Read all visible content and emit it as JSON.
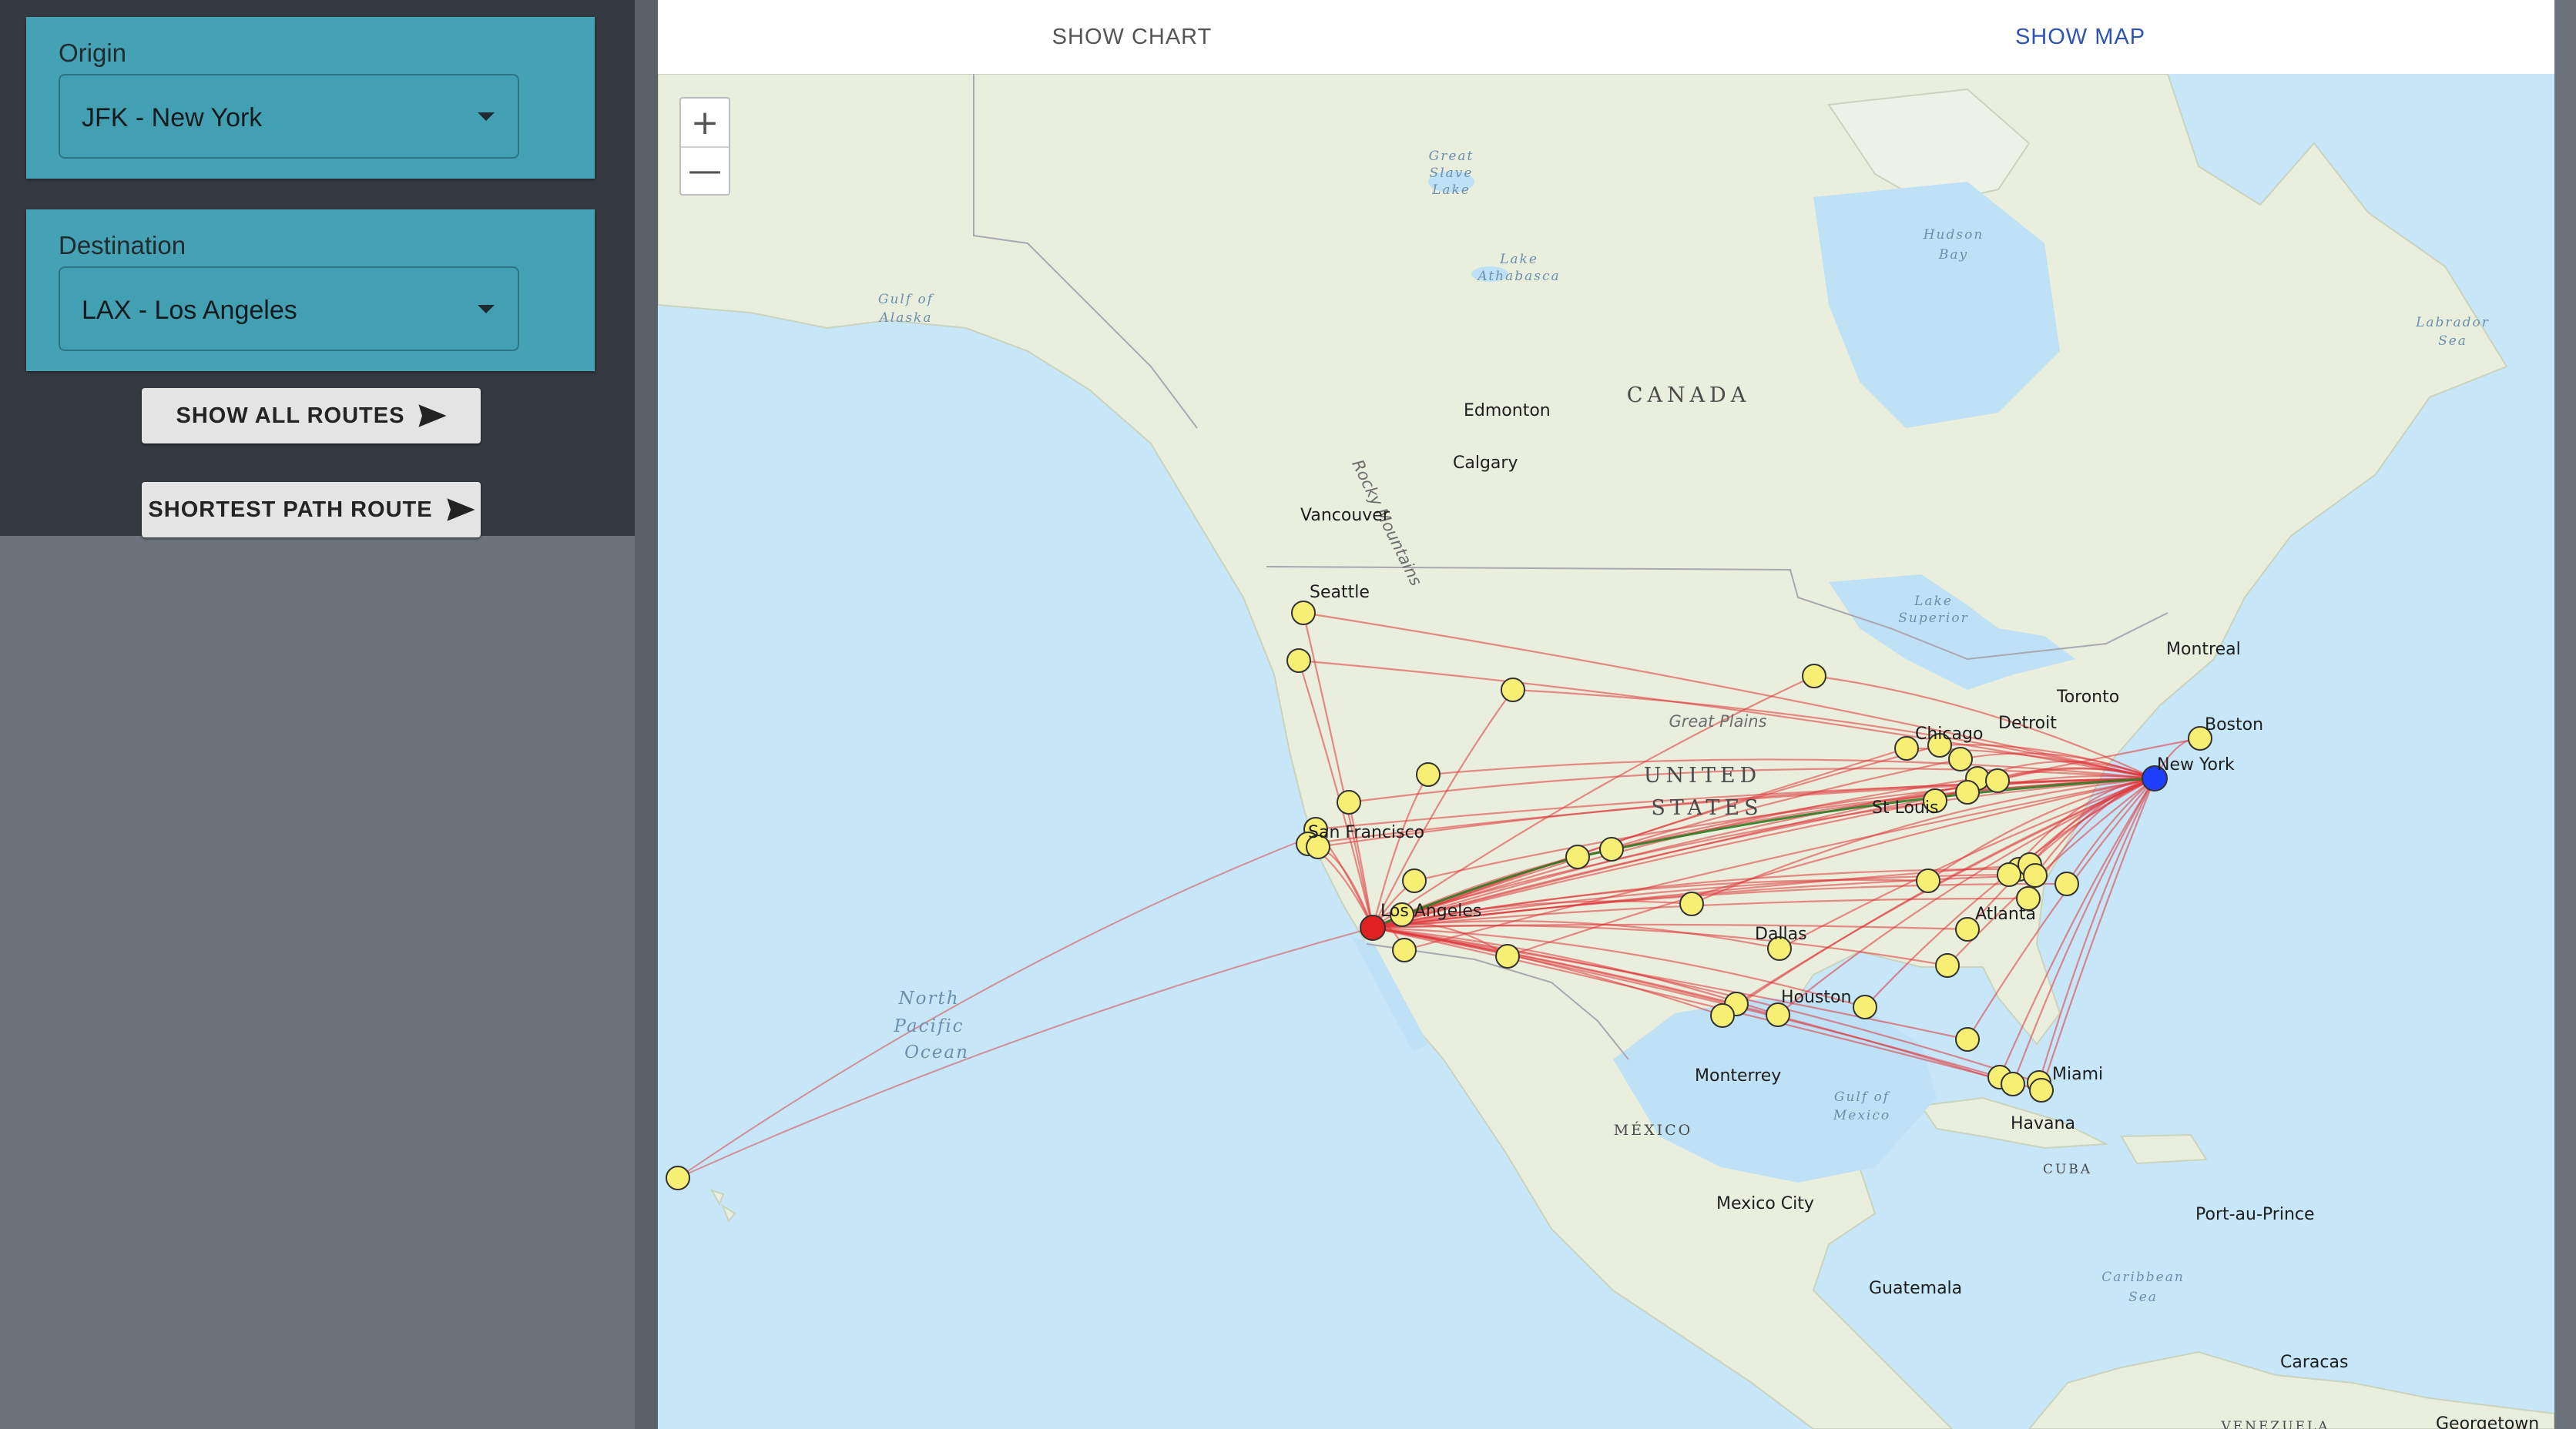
{
  "origin": {
    "label": "Origin",
    "value": "JFK - New York"
  },
  "destination": {
    "label": "Destination",
    "value": "LAX - Los Angeles"
  },
  "buttons": {
    "show_all": "SHOW ALL ROUTES",
    "shortest": "SHORTEST PATH ROUTE"
  },
  "tabs": {
    "chart": "SHOW CHART",
    "map": "SHOW MAP"
  },
  "zoom": {
    "in": "+",
    "out": "—"
  },
  "map": {
    "water_labels": {
      "gulf_alaska": [
        "Gulf of",
        "Alaska"
      ],
      "pacific": [
        "North",
        "Pacific",
        "Ocean"
      ],
      "hudson": [
        "Hudson",
        "Bay"
      ],
      "labrador": [
        "Labrador",
        "Sea"
      ],
      "gulf_mexico": [
        "Gulf of",
        "Mexico"
      ],
      "caribbean": [
        "Caribbean",
        "Sea"
      ],
      "slave": [
        "Great",
        "Slave",
        "Lake"
      ],
      "athabasca": [
        "Lake",
        "Athabasca"
      ],
      "superior": [
        "Lake",
        "Superior"
      ]
    },
    "country_labels": {
      "canada": "CANADA",
      "us1": "UNITED",
      "us2": "STATES",
      "mexico": "MÉXICO",
      "cuba": "CUBA",
      "venezuela": "VENEZUELA"
    },
    "region_labels": {
      "rockies": "Rocky Mountains",
      "plains": "Great Plains"
    },
    "cities": [
      "Edmonton",
      "Calgary",
      "Vancouver",
      "Seattle",
      "Montreal",
      "Toronto",
      "Boston",
      "Detroit",
      "Chicago",
      "New York",
      "St Louis",
      "San Francisco",
      "Los Angeles",
      "Atlanta",
      "Dallas",
      "Houston",
      "Miami",
      "Monterrey",
      "Havana",
      "Mexico City",
      "Port-au-Prince",
      "Guatemala",
      "Caracas",
      "Georgetown"
    ]
  },
  "colors": {
    "route": "#e0353b",
    "shortest": "#2f7a22",
    "origin_marker": "#1f3fff",
    "dest_marker": "#e02020",
    "airport": "#f7ef74"
  }
}
